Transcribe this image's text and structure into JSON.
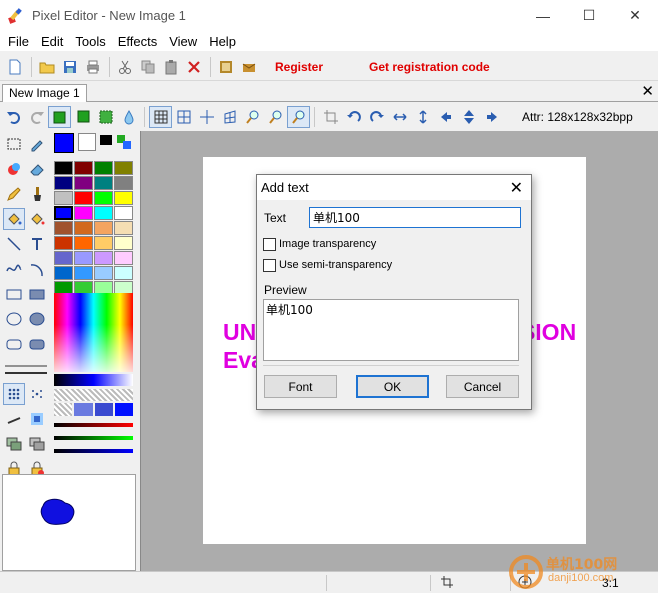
{
  "window": {
    "title": "Pixel Editor - New Image 1",
    "controls": {
      "minimize": "—",
      "maximize": "☐",
      "close": "✕"
    }
  },
  "menu": [
    "File",
    "Edit",
    "Tools",
    "Effects",
    "View",
    "Help"
  ],
  "toolbar": {
    "icons": [
      "new-icon",
      "open-icon",
      "save-icon",
      "print-icon",
      "cut-icon",
      "copy-icon",
      "paste-icon",
      "delete-icon",
      "crop-icon",
      "register-icon"
    ],
    "register_label": "Register",
    "get_code_label": "Get registration code"
  },
  "document_tab": {
    "label": "New Image 1",
    "close": "✕"
  },
  "attr_text": "Attr:  128x128x32bpp",
  "palette_colors": [
    "#000000",
    "#800000",
    "#008000",
    "#808000",
    "#000080",
    "#800080",
    "#008080",
    "#808080",
    "#c0c0c0",
    "#ff0000",
    "#00ff00",
    "#ffff00",
    "#0000ff",
    "#ff00ff",
    "#00ffff",
    "#ffffff",
    "#a0522d",
    "#d2691e",
    "#f4a460",
    "#f5deb3",
    "#cc3300",
    "#ff6600",
    "#ffcc66",
    "#ffffcc",
    "#6666cc",
    "#9999ff",
    "#cc99ff",
    "#ffccff",
    "#0066cc",
    "#3399ff",
    "#99ccff",
    "#ccffff",
    "#009900",
    "#33cc33",
    "#99ff99",
    "#ccffcc"
  ],
  "foreground_color": "#0000ff",
  "canvas": {
    "watermark_left": "UN",
    "watermark_right": "ERSION",
    "watermark_line2": "Eva"
  },
  "status": {
    "zoom": "3:1"
  },
  "dialog": {
    "title": "Add text",
    "text_label": "Text",
    "text_value": "单机100",
    "image_transparency_label": "Image transparency",
    "semi_transparency_label": "Use semi-transparency",
    "image_transparency_checked": false,
    "semi_transparency_checked": false,
    "preview_label": "Preview",
    "preview_text": "单机100",
    "font_button": "Font",
    "ok_button": "OK",
    "cancel_button": "Cancel"
  },
  "watermark_site": "单机100网",
  "watermark_domain": "danji100.com"
}
